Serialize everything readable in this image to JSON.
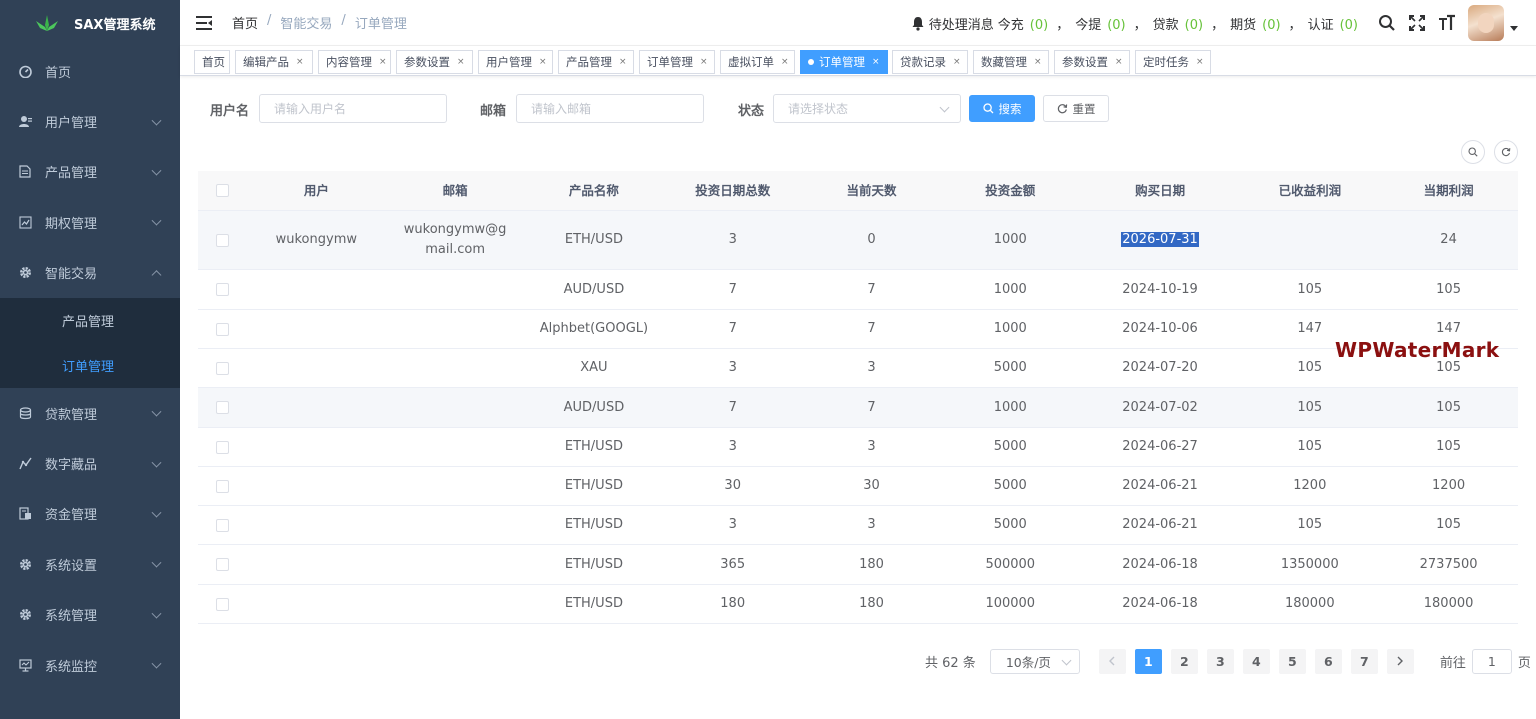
{
  "app": {
    "title": "SAX管理系统"
  },
  "sidebar": {
    "items": [
      {
        "label": "首页",
        "icon": "dashboard-icon",
        "arrow": false
      },
      {
        "label": "用户管理",
        "icon": "user-icon",
        "arrow": true
      },
      {
        "label": "产品管理",
        "icon": "document-icon",
        "arrow": true
      },
      {
        "label": "期权管理",
        "icon": "chart-icon",
        "arrow": true
      },
      {
        "label": "智能交易",
        "icon": "gear-icon",
        "arrow": true,
        "expanded": true
      }
    ],
    "submenu": [
      {
        "label": "产品管理",
        "active": false
      },
      {
        "label": "订单管理",
        "active": true
      }
    ],
    "items_after": [
      {
        "label": "贷款管理",
        "icon": "loan-icon"
      },
      {
        "label": "数字藏品",
        "icon": "collection-icon"
      },
      {
        "label": "资金管理",
        "icon": "funds-icon"
      },
      {
        "label": "系统设置",
        "icon": "gear-icon"
      },
      {
        "label": "系统管理",
        "icon": "gear-icon"
      },
      {
        "label": "系统监控",
        "icon": "monitor-icon"
      }
    ]
  },
  "navbar": {
    "breadcrumb": [
      "首页",
      "/",
      "智能交易",
      "/",
      "订单管理"
    ],
    "pending_label": "待处理消息",
    "stats": [
      {
        "label": "今充",
        "value": "(0)"
      },
      {
        "label": "今提",
        "value": "(0)"
      },
      {
        "label": "贷款",
        "value": "(0)"
      },
      {
        "label": "期货",
        "value": "(0)"
      },
      {
        "label": "认证",
        "value": "(0)"
      }
    ],
    "separator": "，"
  },
  "tags": [
    {
      "label": "首页",
      "closable": false,
      "active": false
    },
    {
      "label": "编辑产品",
      "closable": true,
      "active": false
    },
    {
      "label": "内容管理",
      "closable": true,
      "active": false
    },
    {
      "label": "参数设置",
      "closable": true,
      "active": false
    },
    {
      "label": "用户管理",
      "closable": true,
      "active": false
    },
    {
      "label": "产品管理",
      "closable": true,
      "active": false
    },
    {
      "label": "订单管理",
      "closable": true,
      "active": false
    },
    {
      "label": "虚拟订单",
      "closable": true,
      "active": false
    },
    {
      "label": "订单管理",
      "closable": true,
      "active": true
    },
    {
      "label": "贷款记录",
      "closable": true,
      "active": false
    },
    {
      "label": "数藏管理",
      "closable": true,
      "active": false
    },
    {
      "label": "参数设置",
      "closable": true,
      "active": false
    },
    {
      "label": "定时任务",
      "closable": true,
      "active": false
    }
  ],
  "filters": {
    "username_label": "用户名",
    "username_placeholder": "请输入用户名",
    "email_label": "邮箱",
    "email_placeholder": "请输入邮箱",
    "status_label": "状态",
    "status_placeholder": "请选择状态",
    "search_label": "搜索",
    "reset_label": "重置"
  },
  "table": {
    "columns": [
      "用户",
      "邮箱",
      "产品名称",
      "投资日期总数",
      "当前天数",
      "投资金额",
      "购买日期",
      "已收益利润",
      "当期利润"
    ],
    "rows": [
      {
        "user": "wukongymw",
        "email": "wukongymw@gmail.com",
        "product": "ETH/USD",
        "total_days": "3",
        "current_days": "0",
        "amount": "1000",
        "date": "2026-07-31",
        "earned": "",
        "current_profit": "24"
      },
      {
        "user": "",
        "email": "",
        "product": "AUD/USD",
        "total_days": "7",
        "current_days": "7",
        "amount": "1000",
        "date": "2024-10-19",
        "earned": "105",
        "current_profit": "105"
      },
      {
        "user": "",
        "email": "",
        "product": "Alphbet(GOOGL)",
        "total_days": "7",
        "current_days": "7",
        "amount": "1000",
        "date": "2024-10-06",
        "earned": "147",
        "current_profit": "147"
      },
      {
        "user": "",
        "email": "",
        "product": "XAU",
        "total_days": "3",
        "current_days": "3",
        "amount": "5000",
        "date": "2024-07-20",
        "earned": "105",
        "current_profit": "105"
      },
      {
        "user": "",
        "email": "",
        "product": "AUD/USD",
        "total_days": "7",
        "current_days": "7",
        "amount": "1000",
        "date": "2024-07-02",
        "earned": "105",
        "current_profit": "105"
      },
      {
        "user": "",
        "email": "",
        "product": "ETH/USD",
        "total_days": "3",
        "current_days": "3",
        "amount": "5000",
        "date": "2024-06-27",
        "earned": "105",
        "current_profit": "105"
      },
      {
        "user": "",
        "email": "",
        "product": "ETH/USD",
        "total_days": "30",
        "current_days": "30",
        "amount": "5000",
        "date": "2024-06-21",
        "earned": "1200",
        "current_profit": "1200"
      },
      {
        "user": "",
        "email": "",
        "product": "ETH/USD",
        "total_days": "3",
        "current_days": "3",
        "amount": "5000",
        "date": "2024-06-21",
        "earned": "105",
        "current_profit": "105"
      },
      {
        "user": "",
        "email": "",
        "product": "ETH/USD",
        "total_days": "365",
        "current_days": "180",
        "amount": "500000",
        "date": "2024-06-18",
        "earned": "1350000",
        "current_profit": "2737500"
      },
      {
        "user": "",
        "email": "",
        "product": "ETH/USD",
        "total_days": "180",
        "current_days": "180",
        "amount": "100000",
        "date": "2024-06-18",
        "earned": "180000",
        "current_profit": "180000"
      }
    ]
  },
  "pagination": {
    "total_label": "共 62 条",
    "page_size": "10条/页",
    "pages": [
      "1",
      "2",
      "3",
      "4",
      "5",
      "6",
      "7"
    ],
    "current_page": "1",
    "goto_label": "前往",
    "goto_value": "1",
    "page_suffix": "页"
  },
  "watermark": {
    "text": "WPWaterMark",
    "color": "#8b1010"
  },
  "colors": {
    "sidebar_bg": "#304156",
    "submenu_bg": "#1f2d3d",
    "accent": "#409eff",
    "green": "#67c23a"
  }
}
